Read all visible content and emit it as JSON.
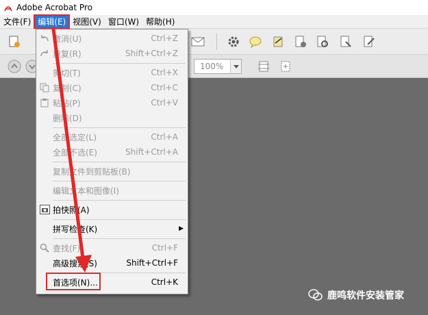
{
  "window": {
    "title": "Adobe Acrobat Pro"
  },
  "menubar": {
    "items": [
      {
        "label": "文件(F)"
      },
      {
        "label": "编辑(E)",
        "active": true
      },
      {
        "label": "视图(V)"
      },
      {
        "label": "窗口(W)"
      },
      {
        "label": "帮助(H)"
      }
    ]
  },
  "toolbar": {
    "zoom_value": "100%"
  },
  "edit_menu": {
    "items": [
      {
        "label": "撤消(U)",
        "shortcut": "Ctrl+Z",
        "disabled": true,
        "icon": "undo-icon"
      },
      {
        "label": "重复(R)",
        "shortcut": "Shift+Ctrl+Z",
        "disabled": true,
        "icon": "redo-icon"
      },
      {
        "label": "剪切(T)",
        "shortcut": "Ctrl+X",
        "disabled": true,
        "icon": ""
      },
      {
        "label": "复制(C)",
        "shortcut": "Ctrl+C",
        "disabled": true,
        "icon": "copy-icon"
      },
      {
        "label": "粘贴(P)",
        "shortcut": "Ctrl+V",
        "disabled": true,
        "icon": "paste-icon"
      },
      {
        "label": "删除(D)",
        "shortcut": "",
        "disabled": true,
        "icon": ""
      },
      {
        "label": "全部选定(L)",
        "shortcut": "Ctrl+A",
        "disabled": true,
        "icon": ""
      },
      {
        "label": "全部不选(E)",
        "shortcut": "Shift+Ctrl+A",
        "disabled": true,
        "icon": ""
      },
      {
        "label": "复制文件到剪贴板(B)",
        "shortcut": "",
        "disabled": true,
        "icon": ""
      },
      {
        "label": "编辑文本和图像(I)",
        "shortcut": "",
        "disabled": true,
        "icon": ""
      },
      {
        "label": "拍快照(A)",
        "shortcut": "",
        "disabled": false,
        "icon": "camera-icon"
      },
      {
        "label": "拼写检查(K)",
        "shortcut": "",
        "disabled": false,
        "icon": "",
        "submenu": true
      },
      {
        "label": "查找(F)",
        "shortcut": "Ctrl+F",
        "disabled": true,
        "icon": "find-icon"
      },
      {
        "label": "高级搜索(S)",
        "shortcut": "Shift+Ctrl+F",
        "disabled": false,
        "icon": ""
      },
      {
        "label": "首选项(N)...",
        "shortcut": "Ctrl+K",
        "disabled": false,
        "icon": ""
      }
    ]
  },
  "watermark": {
    "text": "鹿鸣软件安装管家"
  },
  "colors": {
    "accent": "#2a78d4",
    "annotation": "#e02828"
  }
}
